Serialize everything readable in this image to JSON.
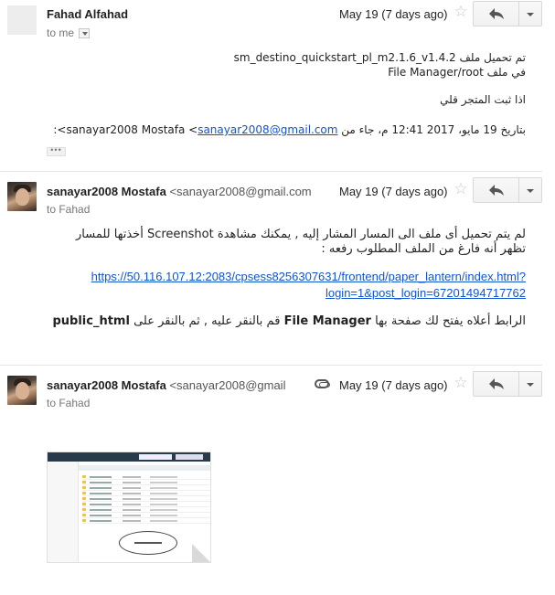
{
  "messages": [
    {
      "sender": "Fahad Alfahad",
      "email": "",
      "to": "to me",
      "date": "May 19 (7 days ago)",
      "has_attachment": false,
      "body": {
        "line1": "تم تحميل ملف sm_destino_quickstart_pl_m2.1.6_v1.4.2",
        "line2": "في ملف File Manager/root",
        "line3": "اذا ثبت المتجر قلي",
        "quote_prefix": "بتاريخ 19 مايو، 2017 12:41 م، جاء من sanayar2008 Mostafa <",
        "quote_email": "sanayar2008@gmail.com",
        "quote_suffix": ">:"
      },
      "ellipsis": "•••"
    },
    {
      "sender": "sanayar2008 Mostafa",
      "email": "<sanayar2008@gmail.com",
      "to": "to Fahad",
      "date": "May 19 (7 days ago)",
      "has_attachment": false,
      "body": {
        "line1": "لم يتم تحميل أى ملف الى المسار المشار إليه , يمكنك مشاهدة Screenshot أخذتها للمسار",
        "line2": "تظهر أنه فارغ من الملف المطلوب رفعه :",
        "link_line1": "https://50.116.107.12:2083/cpsess8256307631/frontend/paper_lantern/index.html?",
        "link_line2": "login=1&post_login=67201494717762",
        "line3_part1": "الرابط أعلاه يفتح لك صفحة بها",
        "line3_bold1": "File Manager",
        "line3_part2": "قم بالنقر عليه , ثم بالنقر على",
        "line3_bold2": "public_html"
      }
    },
    {
      "sender": "sanayar2008 Mostafa",
      "email": "<sanayar2008@gmail",
      "to": "to Fahad",
      "date": "May 19 (7 days ago)",
      "has_attachment": true
    }
  ],
  "icons": {
    "star": "star-icon",
    "reply": "reply-icon",
    "more": "chevron-down-icon",
    "attachment": "paperclip-icon"
  },
  "colors": {
    "link": "#1155cc",
    "muted": "#777777",
    "divider": "#e5e5e5"
  }
}
